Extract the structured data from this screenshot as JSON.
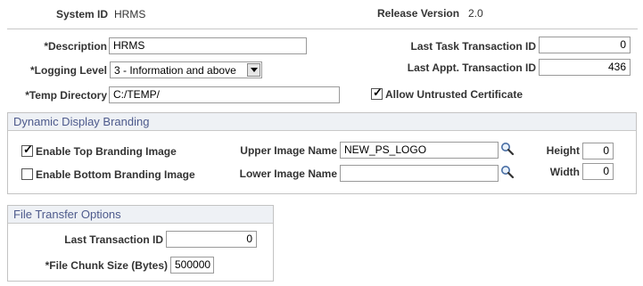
{
  "header": {
    "system_id_label": "System ID",
    "system_id_value": "HRMS",
    "release_version_label": "Release Version",
    "release_version_value": "2.0"
  },
  "general": {
    "description_label": "*Description",
    "description_value": "HRMS",
    "logging_level_label": "*Logging Level",
    "logging_level_value": "3 - Information and above",
    "temp_directory_label": "*Temp Directory",
    "temp_directory_value": "C:/TEMP/",
    "last_task_label": "Last Task Transaction ID",
    "last_task_value": "0",
    "last_appt_label": "Last Appt. Transaction ID",
    "last_appt_value": "436",
    "allow_untrusted_label": "Allow Untrusted Certificate",
    "allow_untrusted_checked": true
  },
  "branding": {
    "title": "Dynamic Display Branding",
    "enable_top_label": "Enable Top Branding Image",
    "enable_top_checked": true,
    "enable_bottom_label": "Enable Bottom Branding Image",
    "enable_bottom_checked": false,
    "upper_image_label": "Upper Image Name",
    "upper_image_value": "NEW_PS_LOGO",
    "lower_image_label": "Lower Image Name",
    "lower_image_value": "",
    "height_label": "Height",
    "height_value": "0",
    "width_label": "Width",
    "width_value": "0"
  },
  "file_transfer": {
    "title": "File Transfer Options",
    "last_transaction_label": "Last Transaction ID",
    "last_transaction_value": "0",
    "chunk_size_label": "*File Chunk Size (Bytes)",
    "chunk_size_value": "500000"
  },
  "icons": {
    "lookup": "search-icon",
    "dropdown": "chevron-down-icon",
    "check": "checkmark-icon"
  },
  "colors": {
    "group_header_bg": "#eef1f5",
    "group_header_text": "#4d5a8c",
    "border": "#c3c3c3"
  }
}
